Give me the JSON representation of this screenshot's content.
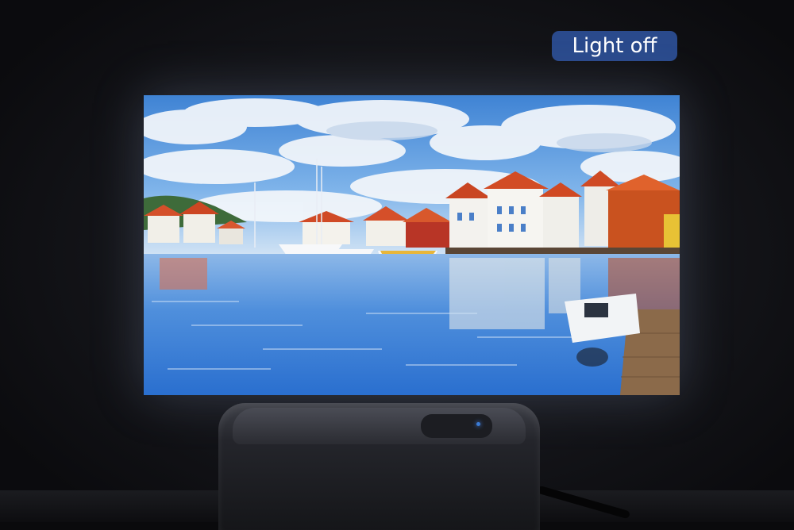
{
  "badge": {
    "label": "Light off",
    "background": "#2a4a8c",
    "text_color": "#ffffff"
  },
  "scene": {
    "screen_icon": "projected-harbor-image",
    "device_icon": "projector-icon"
  },
  "colors": {
    "sky": "#5f98dc",
    "water": "#3b7bd6",
    "roof": "#d4502a",
    "house": "#f2f1ec",
    "room": "#0a0a0c"
  }
}
